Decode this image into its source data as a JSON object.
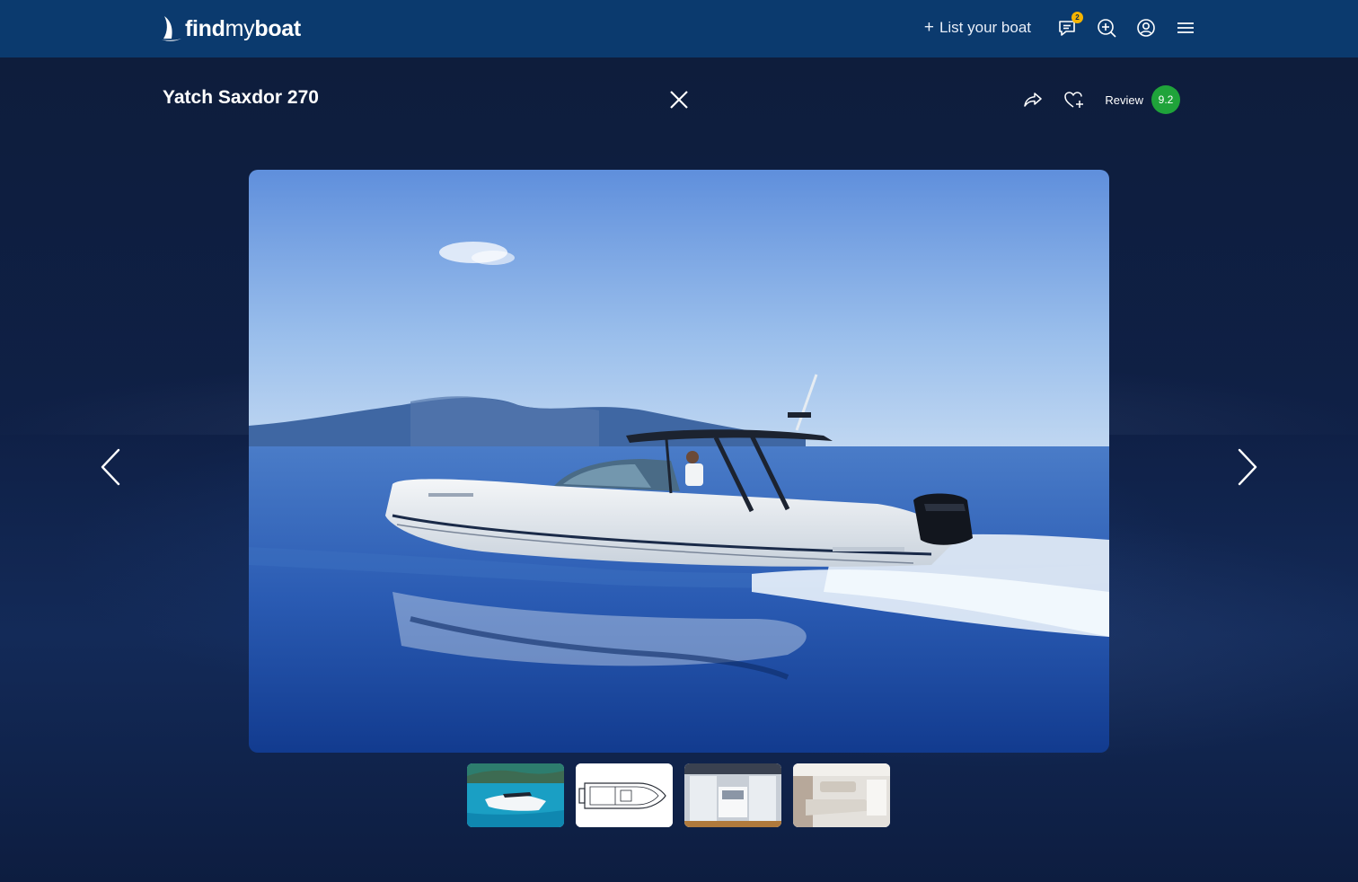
{
  "header": {
    "logo_bold": "find",
    "logo_thin": "my",
    "logo_bold2": "boat",
    "list_boat_label": "List your boat",
    "messages_badge": "2",
    "icons": [
      "sail-logo-icon",
      "chat-icon",
      "add-search-icon",
      "user-icon",
      "menu-icon"
    ]
  },
  "gallery": {
    "title": "Yatch Saxdor 270",
    "review_label": "Review",
    "review_score": "9.2",
    "icons": [
      "close-icon",
      "share-icon",
      "favorite-add-icon",
      "chevron-left-icon",
      "chevron-right-icon"
    ],
    "thumbnails": [
      "boat-at-sea",
      "deck-plan",
      "cockpit-interior",
      "cabin-interior"
    ]
  },
  "colors": {
    "header_bg": "#0b3a6e",
    "page_bg": "#0d1b3a",
    "badge": "#f5b400",
    "score_badge": "#1fa33a"
  }
}
